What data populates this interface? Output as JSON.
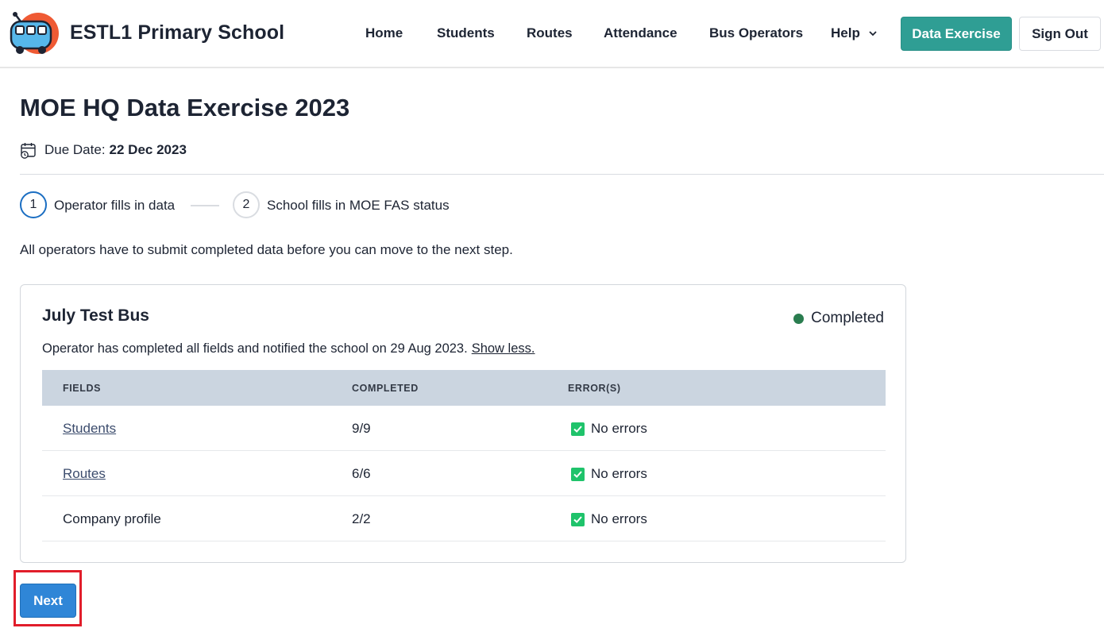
{
  "header": {
    "school_name": "ESTL1 Primary School",
    "logo_icon": "school-bus-logo-icon",
    "nav": {
      "home": "Home",
      "students": "Students",
      "routes": "Routes",
      "attendance": "Attendance",
      "bus_operators": "Bus Operators",
      "help": "Help"
    },
    "data_exercise_label": "Data Exercise",
    "sign_out_label": "Sign Out"
  },
  "page": {
    "title": "MOE HQ Data Exercise 2023",
    "due_label": "Due Date:",
    "due_date": "22 Dec 2023",
    "calendar_icon": "calendar-clock-icon"
  },
  "stepper": {
    "steps": [
      {
        "number": "1",
        "label": "Operator fills in data",
        "active": true
      },
      {
        "number": "2",
        "label": "School fills in MOE FAS status",
        "active": false
      }
    ]
  },
  "instruction": "All operators have to submit completed data before you can move to the next step.",
  "operator_card": {
    "name": "July Test Bus",
    "status": "Completed",
    "status_color": "#2a7d4f",
    "note": "Operator has completed all fields and notified the school on 29 Aug 2023.",
    "toggle_link": "Show less.",
    "table": {
      "headers": [
        "FIELDS",
        "COMPLETED",
        "ERROR(S)"
      ],
      "rows": [
        {
          "field": "Students",
          "completed": "9/9",
          "errors": "No errors"
        },
        {
          "field": "Routes",
          "completed": "6/6",
          "errors": "No errors"
        },
        {
          "field": "Company profile",
          "completed": "2/2",
          "errors": "No errors"
        }
      ]
    }
  },
  "actions": {
    "next_label": "Next",
    "accent": "#2f9e94",
    "primary": "#2f86d7",
    "highlight": "#e11d2a"
  }
}
